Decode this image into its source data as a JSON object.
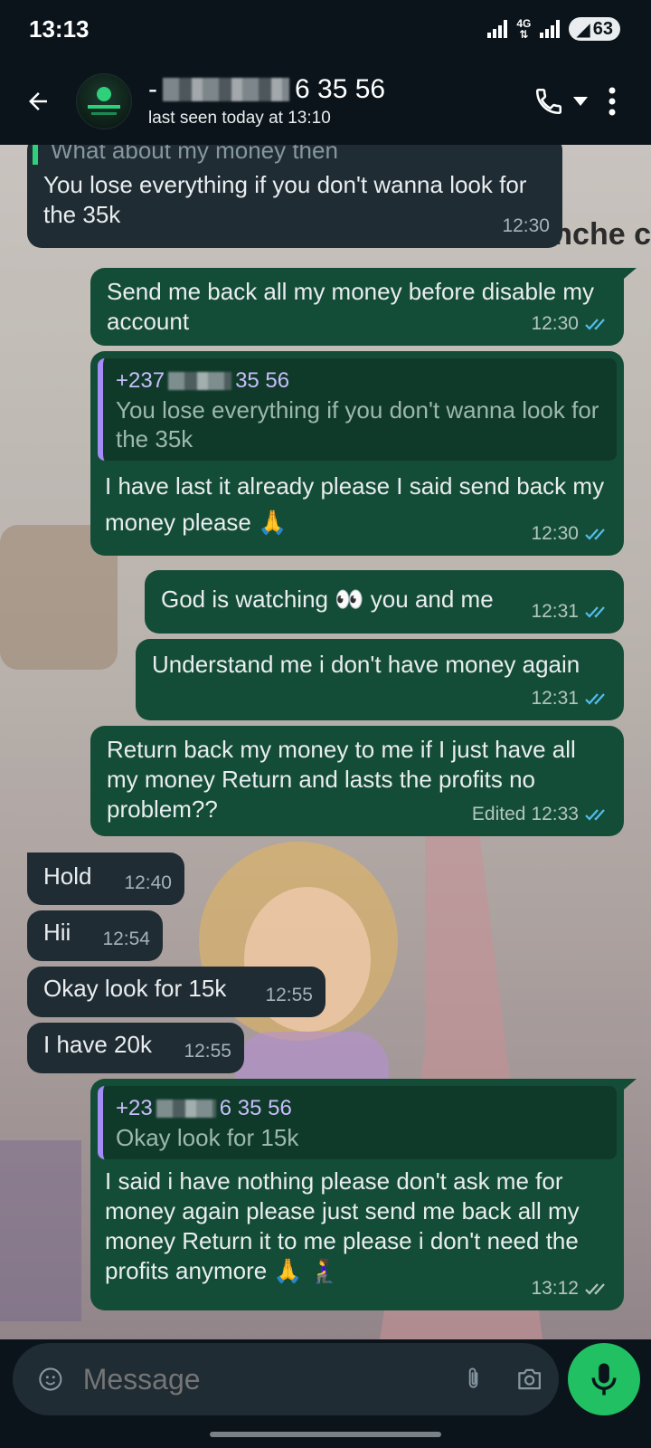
{
  "status_bar": {
    "time": "13:13",
    "network": "4G",
    "battery": "63"
  },
  "header": {
    "contact_name_visible": "6 35 56",
    "contact_status": "last seen today at 13:10"
  },
  "wallpaper": {
    "partial_text": "nche c"
  },
  "messages": [
    {
      "dir": "in",
      "quote_text": "What about my money then",
      "text": "You lose everything if you don't wanna look for the 35k",
      "time": "12:30"
    },
    {
      "dir": "out",
      "text": "Send me back all my money before disable my account",
      "time": "12:30",
      "read": true
    },
    {
      "dir": "out",
      "quote_sender_prefix": "+237",
      "quote_sender_suffix": "35 56",
      "quote_text": "You lose everything if you don't wanna look for the 35k",
      "text": "I have last it already please I said send back my money please 🙏",
      "time": "12:30",
      "read": true
    },
    {
      "dir": "out",
      "text": "God is watching 👀 you and me",
      "time": "12:31",
      "read": true
    },
    {
      "dir": "out",
      "text": "Understand me i don't have money again",
      "time": "12:31",
      "read": true
    },
    {
      "dir": "out",
      "text": "Return back my money to me if I just have all my money Return and lasts the profits no problem??",
      "edited": "Edited",
      "time": "12:33",
      "read": true
    },
    {
      "dir": "in",
      "text": "Hold",
      "time": "12:40"
    },
    {
      "dir": "in",
      "text": "Hii",
      "time": "12:54"
    },
    {
      "dir": "in",
      "text": "Okay look for 15k",
      "time": "12:55"
    },
    {
      "dir": "in",
      "text": "I have 20k",
      "time": "12:55"
    },
    {
      "dir": "out",
      "quote_sender_prefix": "+23",
      "quote_sender_suffix": "6 35 56",
      "quote_text": "Okay look for 15k",
      "text": "I said i have nothing please don't ask me for money again please just send me back all my money Return it to me please i don't need the profits anymore 🙏 🧎‍♀️",
      "time": "13:12",
      "read": false
    }
  ],
  "composer": {
    "placeholder": "Message"
  },
  "colors": {
    "incoming_bubble": "#202c33",
    "outgoing_bubble": "#144d37",
    "read_ticks": "#53bdeb",
    "mic_button": "#21c063"
  }
}
